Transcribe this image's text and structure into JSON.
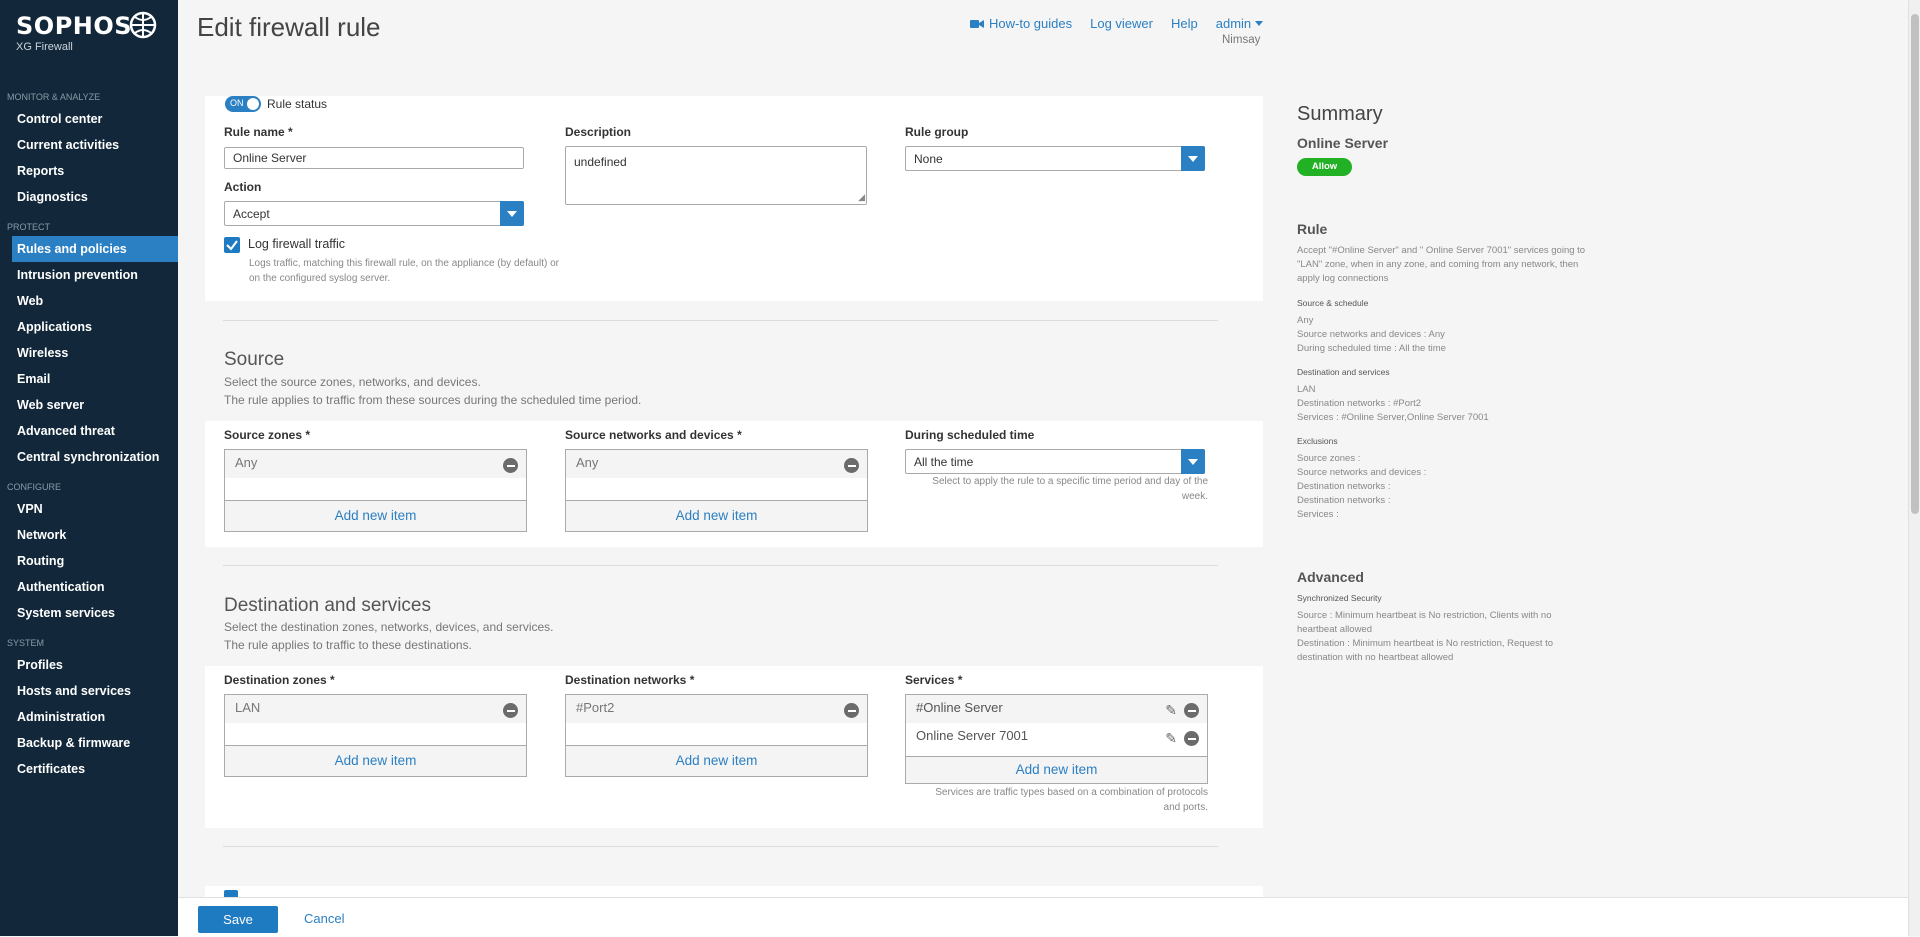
{
  "brand": {
    "name": "SOPHOS",
    "product": "XG Firewall"
  },
  "nav": [
    {
      "type": "section",
      "label": "MONITOR & ANALYZE"
    },
    {
      "type": "item",
      "label": "Control center"
    },
    {
      "type": "item",
      "label": "Current activities"
    },
    {
      "type": "item",
      "label": "Reports"
    },
    {
      "type": "item",
      "label": "Diagnostics"
    },
    {
      "type": "section",
      "label": "PROTECT"
    },
    {
      "type": "item",
      "label": "Rules and policies",
      "active": true
    },
    {
      "type": "item",
      "label": "Intrusion prevention"
    },
    {
      "type": "item",
      "label": "Web"
    },
    {
      "type": "item",
      "label": "Applications"
    },
    {
      "type": "item",
      "label": "Wireless"
    },
    {
      "type": "item",
      "label": "Email"
    },
    {
      "type": "item",
      "label": "Web server"
    },
    {
      "type": "item",
      "label": "Advanced threat"
    },
    {
      "type": "item",
      "label": "Central synchronization"
    },
    {
      "type": "section",
      "label": "CONFIGURE"
    },
    {
      "type": "item",
      "label": "VPN"
    },
    {
      "type": "item",
      "label": "Network"
    },
    {
      "type": "item",
      "label": "Routing"
    },
    {
      "type": "item",
      "label": "Authentication"
    },
    {
      "type": "item",
      "label": "System services"
    },
    {
      "type": "section",
      "label": "SYSTEM"
    },
    {
      "type": "item",
      "label": "Profiles"
    },
    {
      "type": "item",
      "label": "Hosts and services"
    },
    {
      "type": "item",
      "label": "Administration"
    },
    {
      "type": "item",
      "label": "Backup & firmware"
    },
    {
      "type": "item",
      "label": "Certificates"
    }
  ],
  "header": {
    "title": "Edit firewall rule",
    "how_to": "How-to guides",
    "log_viewer": "Log viewer",
    "help": "Help",
    "user": "admin",
    "user_sub": "Nimsay"
  },
  "rule": {
    "toggle_label": "ON",
    "status_label": "Rule status",
    "name_label": "Rule name *",
    "name_value": "Online Server",
    "description_label": "Description",
    "description_value": "undefined",
    "group_label": "Rule group",
    "group_value": "None",
    "action_label": "Action",
    "action_value": "Accept",
    "log_label": "Log firewall traffic",
    "log_help": "Logs traffic, matching this firewall rule, on the appliance (by default) or on the configured syslog server."
  },
  "source": {
    "title": "Source",
    "desc1": "Select the source zones, networks, and devices.",
    "desc2": "The rule applies to traffic from these sources during the scheduled time period.",
    "zones_label": "Source zones *",
    "zones_items": [
      "Any"
    ],
    "networks_label": "Source networks and devices *",
    "networks_items": [
      "Any"
    ],
    "schedule_label": "During scheduled time",
    "schedule_value": "All the time",
    "schedule_help": "Select to apply the rule to a specific time period and day of the week.",
    "add_new": "Add new item"
  },
  "destination": {
    "title": "Destination and services",
    "desc1": "Select the destination zones, networks, devices, and services.",
    "desc2": "The rule applies to traffic to these destinations.",
    "zones_label": "Destination zones *",
    "zones_items": [
      "LAN"
    ],
    "networks_label": "Destination networks *",
    "networks_items": [
      "#Port2"
    ],
    "services_label": "Services *",
    "services_items": [
      "#Online Server",
      "Online Server 7001"
    ],
    "services_help": "Services are traffic types based on a combination of protocols and ports.",
    "add_new": "Add new item"
  },
  "summary": {
    "title": "Summary",
    "rule_name": "Online Server",
    "badge": "Allow",
    "badge_color": "#22b024",
    "rule_heading": "Rule",
    "rule_text": "Accept \"#Online Server\" and \" Online Server 7001\" services going to \"LAN\" zone, when in any zone, and coming from any network, then apply log connections",
    "src_heading": "Source & schedule",
    "src_lines": [
      "Any",
      "Source networks and devices : Any",
      "During scheduled time : All the time"
    ],
    "dst_heading": "Destination and services",
    "dst_lines": [
      "LAN",
      "Destination networks : #Port2",
      "Services : #Online Server,Online Server 7001"
    ],
    "exc_heading": "Exclusions",
    "exc_lines": [
      "Source zones :",
      "Source networks and devices :",
      "Destination networks :",
      "Destination networks :",
      "Services :"
    ],
    "adv_heading": "Advanced",
    "sync_heading": "Synchronized Security",
    "sync_lines": [
      "Source : Minimum heartbeat is No restriction, Clients with no heartbeat allowed",
      "Destination : Minimum heartbeat is No restriction, Request to destination with no heartbeat allowed"
    ]
  },
  "footer": {
    "save": "Save",
    "cancel": "Cancel"
  },
  "colors": {
    "sidebar": "#12283a",
    "accent": "#2b7fc3",
    "active": "#2b7fc3"
  }
}
